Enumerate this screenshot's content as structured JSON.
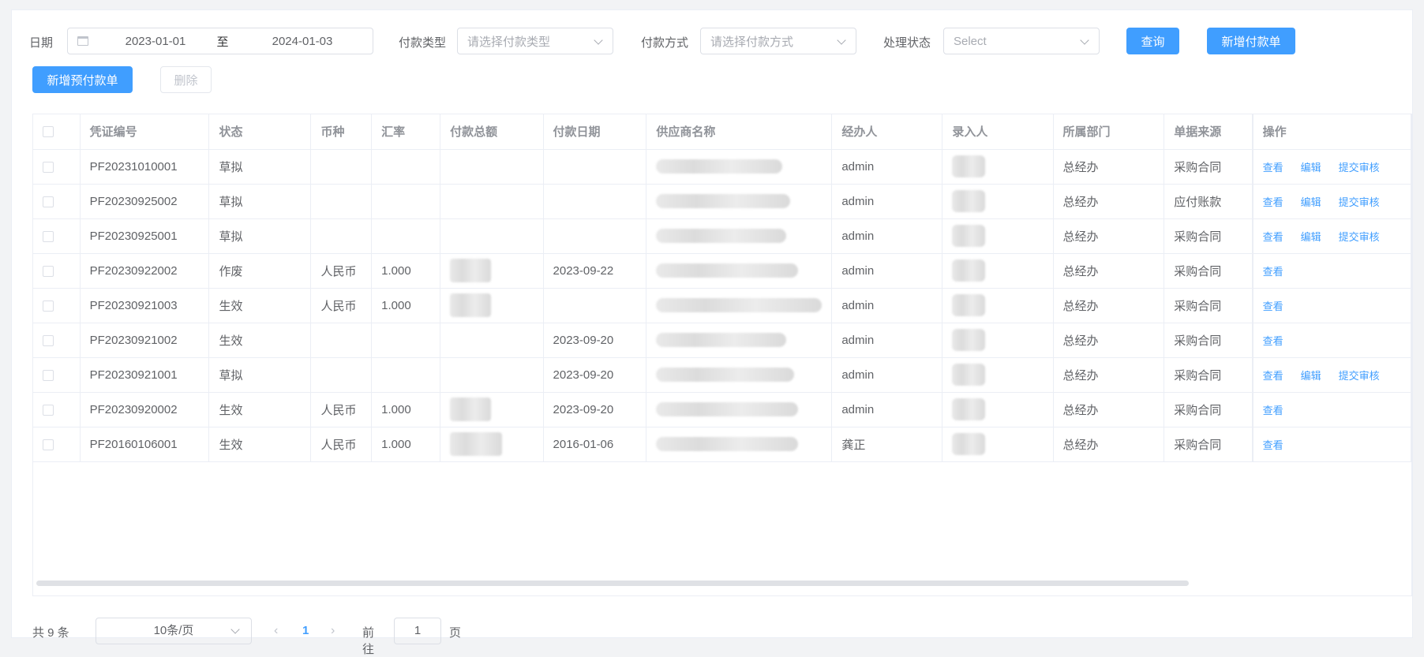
{
  "filters": {
    "date_label": "日期",
    "date_start": "2023-01-01",
    "date_sep": "至",
    "date_end": "2024-01-03",
    "pay_type_label": "付款类型",
    "pay_type_placeholder": "请选择付款类型",
    "pay_method_label": "付款方式",
    "pay_method_placeholder": "请选择付款方式",
    "status_label": "处理状态",
    "status_placeholder": "Select"
  },
  "buttons": {
    "query": "查询",
    "new_payment": "新增付款单",
    "new_prepay": "新增预付款单",
    "delete": "删除"
  },
  "table": {
    "columns": [
      "凭证编号",
      "状态",
      "币种",
      "汇率",
      "付款总额",
      "付款日期",
      "供应商名称",
      "经办人",
      "录入人",
      "所属部门",
      "单据来源",
      "操作"
    ],
    "actions": {
      "view": "查看",
      "edit": "编辑",
      "submit": "提交审核"
    },
    "rows": [
      {
        "code": "PF20231010001",
        "status": "草拟",
        "currency": "",
        "rate": "",
        "date": "",
        "handler": "admin",
        "dept": "总经办",
        "source": "采购合同",
        "editable": true
      },
      {
        "code": "PF20230925002",
        "status": "草拟",
        "currency": "",
        "rate": "",
        "date": "",
        "handler": "admin",
        "dept": "总经办",
        "source": "应付账款",
        "editable": true
      },
      {
        "code": "PF20230925001",
        "status": "草拟",
        "currency": "",
        "rate": "",
        "date": "",
        "handler": "admin",
        "dept": "总经办",
        "source": "采购合同",
        "editable": true
      },
      {
        "code": "PF20230922002",
        "status": "作废",
        "currency": "人民币",
        "rate": "1.000",
        "date": "2023-09-22",
        "handler": "admin",
        "dept": "总经办",
        "source": "采购合同",
        "editable": false
      },
      {
        "code": "PF20230921003",
        "status": "生效",
        "currency": "人民币",
        "rate": "1.000",
        "date": "",
        "handler": "admin",
        "dept": "总经办",
        "source": "采购合同",
        "editable": false
      },
      {
        "code": "PF20230921002",
        "status": "生效",
        "currency": "",
        "rate": "",
        "date": "2023-09-20",
        "handler": "admin",
        "dept": "总经办",
        "source": "采购合同",
        "editable": false
      },
      {
        "code": "PF20230921001",
        "status": "草拟",
        "currency": "",
        "rate": "",
        "date": "2023-09-20",
        "handler": "admin",
        "dept": "总经办",
        "source": "采购合同",
        "editable": true
      },
      {
        "code": "PF20230920002",
        "status": "生效",
        "currency": "人民币",
        "rate": "1.000",
        "date": "2023-09-20",
        "handler": "admin",
        "dept": "总经办",
        "source": "采购合同",
        "editable": false
      },
      {
        "code": "PF20160106001",
        "status": "生效",
        "currency": "人民币",
        "rate": "1.000",
        "date": "2016-01-06",
        "handler": "龚正",
        "dept": "总经办",
        "source": "采购合同",
        "editable": false
      }
    ]
  },
  "pagination": {
    "total": "共 9 条",
    "page_size": "10条/页",
    "current": "1",
    "goto_label": "前往",
    "goto_value": "1",
    "goto_unit": "页"
  }
}
